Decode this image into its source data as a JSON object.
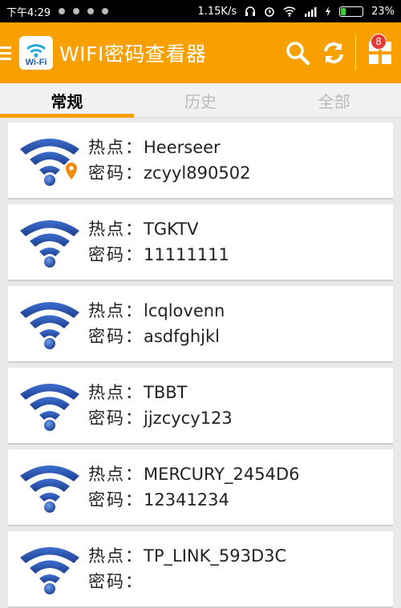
{
  "status_bar": {
    "time": "下午4:29",
    "speed": "1.15K/s",
    "battery": "23%",
    "battery_level": 0.23
  },
  "app_bar": {
    "logo_text": "Wi-Fi",
    "title": "WIFI密码查看器",
    "badge_count": "8"
  },
  "tabs": [
    {
      "label": "常规"
    },
    {
      "label": "历史"
    },
    {
      "label": "全部"
    }
  ],
  "labels": {
    "ssid": "热点：",
    "password": "密码："
  },
  "networks": [
    {
      "ssid": "Heerseer",
      "password": "zcyyl890502",
      "connected": true
    },
    {
      "ssid": "TGKTV",
      "password": "11111111",
      "connected": false
    },
    {
      "ssid": "lcqlovenn",
      "password": "asdfghjkl",
      "connected": false
    },
    {
      "ssid": "TBBT",
      "password": "jjzcycy123",
      "connected": false
    },
    {
      "ssid": "MERCURY_2454D6",
      "password": "12341234",
      "connected": false
    },
    {
      "ssid": "TP_LINK_593D3C",
      "password": "",
      "connected": false
    }
  ],
  "colors": {
    "accent": "#f7a000",
    "wifi_blue": "#2a4fa8",
    "location_pin": "#f28a0f"
  }
}
